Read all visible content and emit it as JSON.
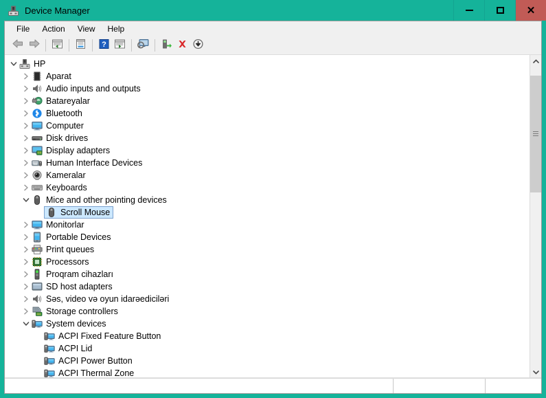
{
  "window": {
    "title": "Device Manager",
    "app_icon": "device-manager-icon",
    "accent_color": "#15b39a",
    "close_color": "#c15b56",
    "controls": {
      "minimize_label": "—",
      "maximize_label": "❐",
      "close_label": "✕"
    }
  },
  "menubar": {
    "items": [
      {
        "label": "File",
        "name": "menu-file"
      },
      {
        "label": "Action",
        "name": "menu-action"
      },
      {
        "label": "View",
        "name": "menu-view"
      },
      {
        "label": "Help",
        "name": "menu-help"
      }
    ]
  },
  "toolbar": {
    "buttons": [
      {
        "icon": "back-arrow-icon",
        "tooltip": "Back"
      },
      {
        "icon": "forward-arrow-icon",
        "tooltip": "Forward"
      },
      {
        "icon": "show-hide-console-tree-icon",
        "tooltip": "Show/Hide Console Tree"
      },
      {
        "icon": "properties-icon",
        "tooltip": "Properties"
      },
      {
        "icon": "help-icon",
        "tooltip": "Help"
      },
      {
        "icon": "update-driver-icon",
        "tooltip": "Update Driver Software"
      },
      {
        "icon": "display-icon",
        "tooltip": "Display"
      },
      {
        "icon": "scan-for-hardware-changes-icon",
        "tooltip": "Scan for hardware changes"
      },
      {
        "icon": "uninstall-device-icon",
        "tooltip": "Uninstall device"
      },
      {
        "icon": "disable-device-icon",
        "tooltip": "Disable device"
      }
    ]
  },
  "tree": {
    "rows": [
      {
        "label": "HP",
        "depth": 0,
        "state": "expanded",
        "icon": "computer-root-icon",
        "selected": false
      },
      {
        "label": "Aparat",
        "depth": 1,
        "state": "collapsed",
        "icon": "firmware-icon",
        "selected": false
      },
      {
        "label": "Audio inputs and outputs",
        "depth": 1,
        "state": "collapsed",
        "icon": "speaker-icon",
        "selected": false
      },
      {
        "label": "Batareyalar",
        "depth": 1,
        "state": "collapsed",
        "icon": "battery-icon",
        "selected": false
      },
      {
        "label": "Bluetooth",
        "depth": 1,
        "state": "collapsed",
        "icon": "bluetooth-icon",
        "selected": false
      },
      {
        "label": "Computer",
        "depth": 1,
        "state": "collapsed",
        "icon": "monitor-icon",
        "selected": false
      },
      {
        "label": "Disk drives",
        "depth": 1,
        "state": "collapsed",
        "icon": "disk-drive-icon",
        "selected": false
      },
      {
        "label": "Display adapters",
        "depth": 1,
        "state": "collapsed",
        "icon": "display-adapter-icon",
        "selected": false
      },
      {
        "label": "Human Interface Devices",
        "depth": 1,
        "state": "collapsed",
        "icon": "hid-icon",
        "selected": false
      },
      {
        "label": "Kameralar",
        "depth": 1,
        "state": "collapsed",
        "icon": "camera-icon",
        "selected": false
      },
      {
        "label": "Keyboards",
        "depth": 1,
        "state": "collapsed",
        "icon": "keyboard-icon",
        "selected": false
      },
      {
        "label": "Mice and other pointing devices",
        "depth": 1,
        "state": "expanded",
        "icon": "mouse-icon",
        "selected": false
      },
      {
        "label": "Scroll Mouse",
        "depth": 2,
        "state": "leaf",
        "icon": "mouse-icon",
        "selected": true
      },
      {
        "label": "Monitorlar",
        "depth": 1,
        "state": "collapsed",
        "icon": "monitor-icon",
        "selected": false
      },
      {
        "label": "Portable Devices",
        "depth": 1,
        "state": "collapsed",
        "icon": "portable-device-icon",
        "selected": false
      },
      {
        "label": "Print queues",
        "depth": 1,
        "state": "collapsed",
        "icon": "printer-icon",
        "selected": false
      },
      {
        "label": "Processors",
        "depth": 1,
        "state": "collapsed",
        "icon": "processor-icon",
        "selected": false
      },
      {
        "label": "Proqram cihazları",
        "depth": 1,
        "state": "collapsed",
        "icon": "software-device-icon",
        "selected": false
      },
      {
        "label": "SD host adapters",
        "depth": 1,
        "state": "collapsed",
        "icon": "sd-host-icon",
        "selected": false
      },
      {
        "label": "Səs, video və oyun idarəediciləri",
        "depth": 1,
        "state": "collapsed",
        "icon": "speaker-icon",
        "selected": false
      },
      {
        "label": "Storage controllers",
        "depth": 1,
        "state": "collapsed",
        "icon": "storage-controller-icon",
        "selected": false
      },
      {
        "label": "System devices",
        "depth": 1,
        "state": "expanded",
        "icon": "system-device-icon",
        "selected": false
      },
      {
        "label": "ACPI Fixed Feature Button",
        "depth": 2,
        "state": "leaf",
        "icon": "system-device-icon",
        "selected": false
      },
      {
        "label": "ACPI Lid",
        "depth": 2,
        "state": "leaf",
        "icon": "system-device-icon",
        "selected": false
      },
      {
        "label": "ACPI Power Button",
        "depth": 2,
        "state": "leaf",
        "icon": "system-device-icon",
        "selected": false
      },
      {
        "label": "ACPI Thermal Zone",
        "depth": 2,
        "state": "leaf",
        "icon": "system-device-icon",
        "selected": false
      }
    ],
    "selection_bg": "#cce8ff",
    "selection_border": "#7da2ce"
  },
  "scrollbar": {
    "up_arrow": "chevron-up-icon",
    "down_arrow": "chevron-down-icon",
    "thumb_top_pct": 3,
    "thumb_height_pct": 39
  },
  "statusbar": {
    "pane1": "",
    "pane2": "",
    "pane3": ""
  }
}
